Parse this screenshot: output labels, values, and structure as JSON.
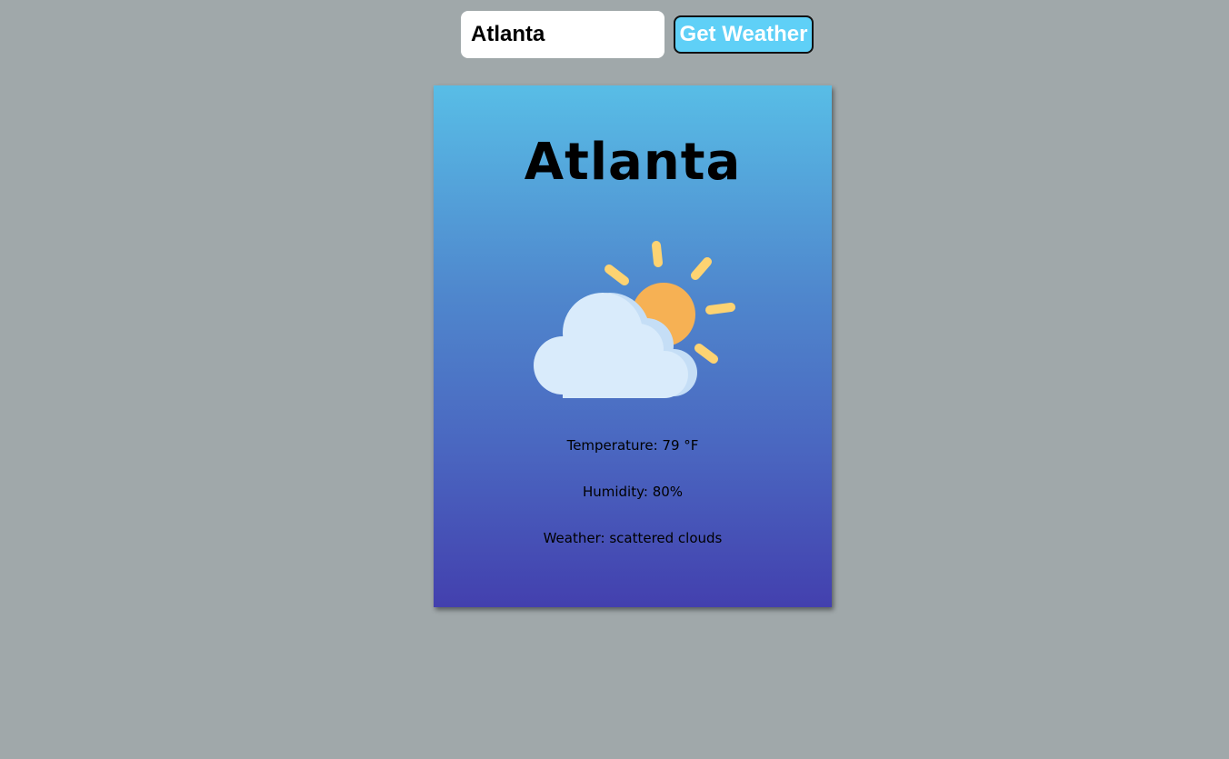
{
  "search": {
    "value": "Atlanta",
    "button_label": "Get Weather"
  },
  "card": {
    "city": "Atlanta",
    "icon": "partly-cloudy-sun-icon",
    "temperature_text": "Temperature: 79 °F",
    "humidity_text": "Humidity: 80%",
    "weather_text": "Weather: scattered clouds"
  },
  "colors": {
    "page_background": "#a0a8aa",
    "button_background": "#5fd0f7",
    "card_gradient_top": "#58bde6",
    "card_gradient_bottom": "#4340ae",
    "sun": "#f6b154",
    "sun_rays": "#fdd372",
    "cloud": "#d9ebfb"
  }
}
